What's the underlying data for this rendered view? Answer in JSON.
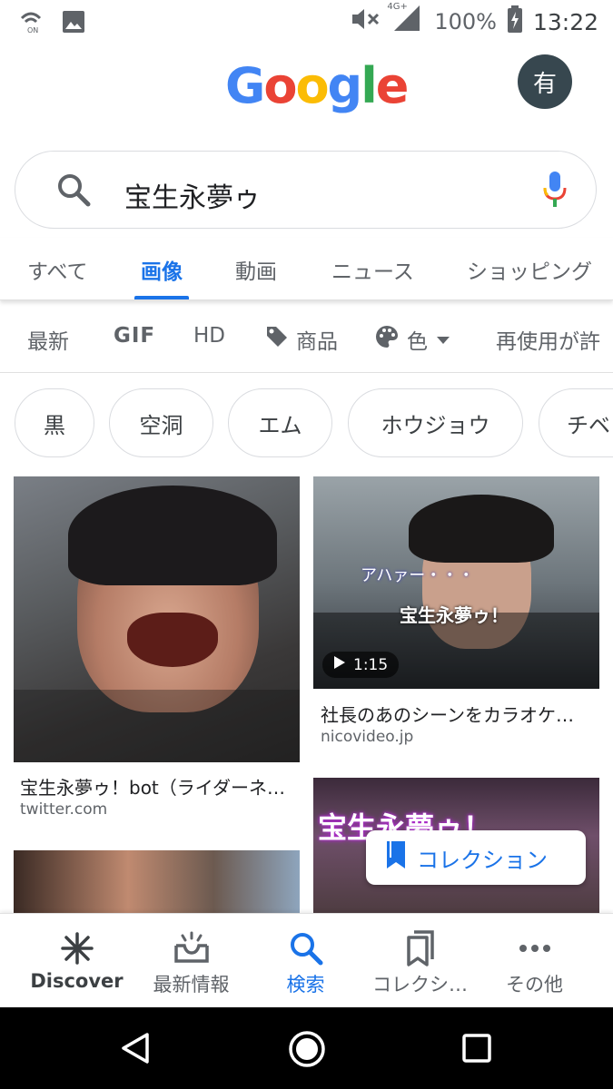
{
  "status_bar": {
    "battery": "100%",
    "time": "13:22",
    "network": "4G+"
  },
  "header": {
    "logo_letters": [
      "G",
      "o",
      "o",
      "g",
      "l",
      "e"
    ],
    "avatar_initial": "有"
  },
  "search": {
    "query": "宝生永夢ゥ"
  },
  "tabs": [
    {
      "label": "すべて",
      "active": false
    },
    {
      "label": "画像",
      "active": true
    },
    {
      "label": "動画",
      "active": false
    },
    {
      "label": "ニュース",
      "active": false
    },
    {
      "label": "ショッピング",
      "active": false
    }
  ],
  "filters": {
    "latest": "最新",
    "gif": "GIF",
    "hd": "HD",
    "products": "商品",
    "color": "色",
    "reuse": "再使用が許"
  },
  "chips": [
    "黒",
    "空洞",
    "エム",
    "ホウジョウ",
    "チベ"
  ],
  "results": [
    {
      "caption": "宝生永夢ゥ！bot（ライダーネ…",
      "source": "twitter.com"
    },
    {
      "caption": "社長のあのシーンをカラオケ…",
      "source": "nicovideo.jp",
      "duration": "1:15"
    }
  ],
  "thumb_overlays": {
    "video1_text_a": "アハァー・・・",
    "video1_text_b": "宝生永夢ゥ！",
    "video2_text": "宝生永夢ゥ！"
  },
  "collection_button": "コレクション",
  "bottom_nav": [
    {
      "label": "Discover",
      "icon": "asterisk-icon"
    },
    {
      "label": "最新情報",
      "icon": "updates-tray-icon"
    },
    {
      "label": "検索",
      "icon": "search-icon",
      "active": true
    },
    {
      "label": "コレクシ…",
      "icon": "collections-icon"
    },
    {
      "label": "その他",
      "icon": "more-dots-icon"
    }
  ],
  "colors": {
    "accent": "#1a73e8",
    "google_blue": "#4285F4",
    "google_red": "#EA4335",
    "google_yellow": "#FBBC05",
    "google_green": "#34A853",
    "avatar_bg": "#37474f"
  }
}
